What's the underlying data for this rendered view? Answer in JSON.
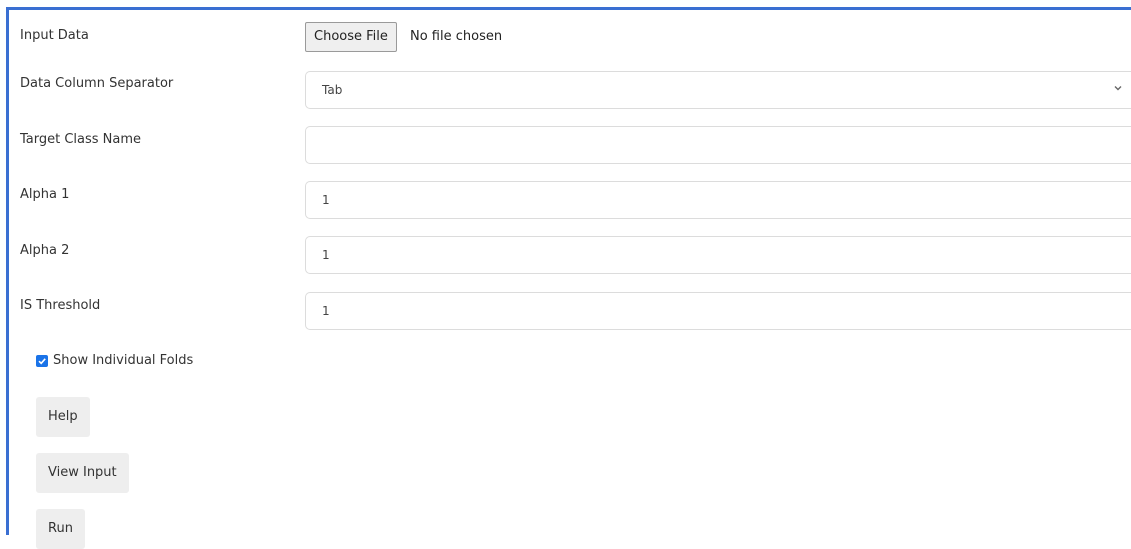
{
  "form": {
    "input_data_label": "Input Data",
    "choose_file_label": "Choose File",
    "file_status": "No file chosen",
    "separator_label": "Data Column Separator",
    "separator_value": "Tab",
    "target_class_label": "Target Class Name",
    "target_class_value": "",
    "alpha1_label": "Alpha 1",
    "alpha1_value": "1",
    "alpha2_label": "Alpha 2",
    "alpha2_value": "1",
    "is_threshold_label": "IS Threshold",
    "is_threshold_value": "1",
    "show_folds_label": "Show Individual Folds",
    "show_folds_checked": true
  },
  "buttons": {
    "help": "Help",
    "view_input": "View Input",
    "run": "Run"
  },
  "colors": {
    "frame_accent": "#3a6fd2",
    "checkbox": "#1a73e8",
    "button_bg": "#eeeeee"
  },
  "icons": {
    "select_caret": "chevron-down-icon",
    "checkbox_mark": "checkmark-icon"
  }
}
